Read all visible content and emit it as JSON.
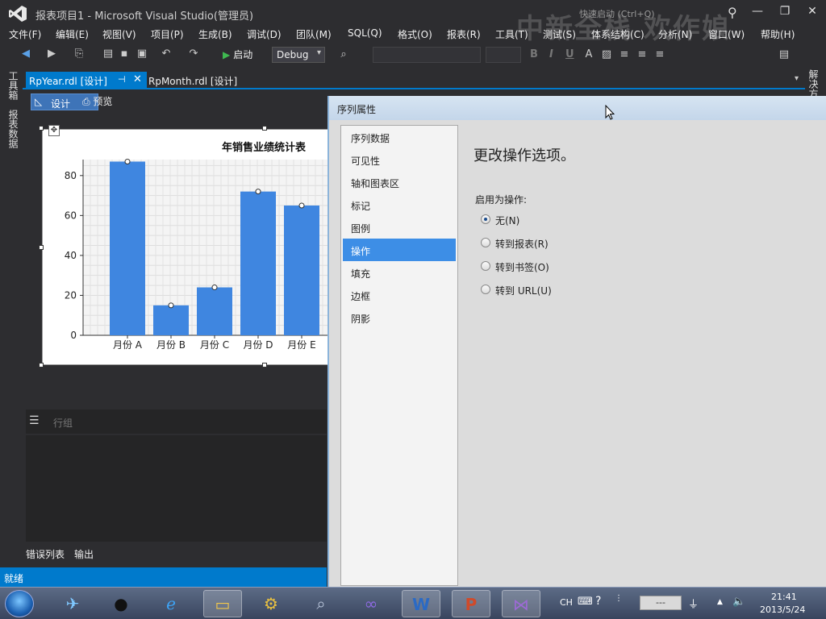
{
  "window": {
    "title": "报表项目1 - Microsoft Visual Studio(管理员)",
    "quick_launch": "快速启动 (Ctrl+Q)",
    "watermark": "中新全栈 欢作娘"
  },
  "menu": [
    "文件(F)",
    "编辑(E)",
    "视图(V)",
    "项目(P)",
    "生成(B)",
    "调试(D)",
    "团队(M)",
    "SQL(Q)",
    "格式(O)",
    "报表(R)",
    "工具(T)",
    "测试(S)",
    "体系结构(C)",
    "分析(N)",
    "窗口(W)",
    "帮助(H)"
  ],
  "toolbar": {
    "start_label": "启动",
    "config_label": "Debug",
    "format_buttons": [
      "B",
      "I",
      "U"
    ]
  },
  "side_tabs": {
    "toolbox": "工具箱",
    "report_data": "报表数据",
    "right": "解决方案"
  },
  "doc_tabs": {
    "active": "RpYear.rdl [设计]",
    "second": "RpMonth.rdl [设计]"
  },
  "view_tabs": {
    "design": "设计",
    "preview": "预览"
  },
  "chart_data": {
    "type": "bar",
    "title": "年销售业绩统计表",
    "categories": [
      "月份 A",
      "月份 B",
      "月份 C",
      "月份 D",
      "月份 E"
    ],
    "values": [
      87,
      15,
      24,
      72,
      65
    ],
    "ylim": [
      0,
      88
    ],
    "yticks": [
      0,
      20,
      40,
      60,
      80
    ],
    "grid": true,
    "bar_color": "#3f86e0"
  },
  "row_group": {
    "label": "行组"
  },
  "output_tabs": [
    "错误列表",
    "输出"
  ],
  "status": {
    "text": "就绪"
  },
  "dialog": {
    "title": "序列属性",
    "nav": [
      "序列数据",
      "可见性",
      "轴和图表区",
      "标记",
      "图例",
      "操作",
      "填充",
      "边框",
      "阴影"
    ],
    "active_nav": "操作",
    "heading": "更改操作选项。",
    "sublabel": "启用为操作:",
    "options": [
      "无(N)",
      "转到报表(R)",
      "转到书签(O)",
      "转到 URL(U)"
    ],
    "selected_option": "无(N)"
  },
  "taskbar": {
    "lang": "CH",
    "tray_box": "---",
    "time": "21:41",
    "date": "2013/5/24"
  },
  "colors": {
    "accent": "#007acc",
    "dialog_select": "#3d8ee6"
  }
}
